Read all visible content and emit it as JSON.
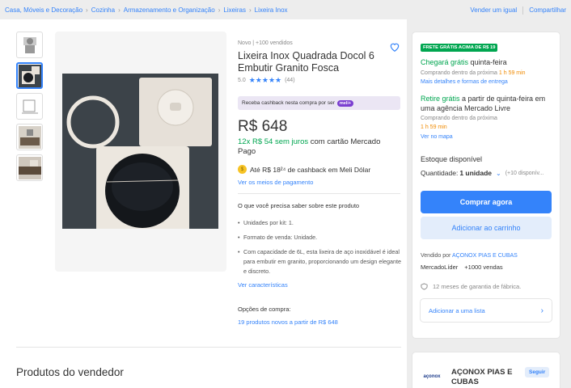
{
  "breadcrumb": [
    "Casa, Móveis e Decoração",
    "Cozinha",
    "Armazenamento e Organização",
    "Lixeiras",
    "Lixeira Inox"
  ],
  "top_links": {
    "sell": "Vender um igual",
    "share": "Compartilhar"
  },
  "product": {
    "condition": "Novo  |  +100 vendidos",
    "title": "Lixeira Inox Quadrada Docol 6 Embutir Granito Fosca",
    "rating_value": "5.0",
    "stars": "★★★★★",
    "reviews": "(44)",
    "cashback_badge": "Receba cashback nesta compra por ser",
    "cashback_pill": "meli+",
    "price": "R$ 648",
    "installments_green": "12x R$ 54 sem juros",
    "installments_rest": " com cartão Mercado Pago",
    "cashback_line": "Até R$ 18²⁴ de cashback em Meli Dólar",
    "payment_link": "Ver os meios de pagamento",
    "know_title": "O que você precisa saber sobre este produto",
    "bullets": [
      "Unidades por kit: 1.",
      "Formato de venda: Unidade.",
      "Com capacidade de 6L, esta lixeira de aço inoxidável é ideal para embutir em granito, proporcionando um design elegante e discreto."
    ],
    "characteristics_link": "Ver características",
    "options_title": "Opções de compra:",
    "options_link": "19 produtos novos a partir de R$ 648"
  },
  "seller_products_title": "Produtos do vendedor",
  "buybox": {
    "free_badge": "FRETE GRÁTIS ACIMA DE R$ 19",
    "arrives_green": "Chegará grátis",
    "arrives_rest": " quinta-feira",
    "arrives_buying": "Comprando dentro da próxima ",
    "arrives_time": "1 h 59 min",
    "more_details": "Mais detalhes e formas de entrega",
    "pickup_green": "Retire grátis",
    "pickup_rest": " a partir de quinta-feira em",
    "pickup_line2": "uma agência Mercado Livre",
    "pickup_buying": "Comprando dentro da próxima",
    "pickup_time": "1 h 59 min",
    "see_map": "Ver no mapa",
    "stock": "Estoque disponível",
    "quantity_label": "Quantidade: ",
    "quantity_value": "1 unidade",
    "quantity_avail": "(+10 disponív...",
    "buy_now": "Comprar agora",
    "add_cart": "Adicionar ao carrinho",
    "sold_by": "Vendido por ",
    "seller_link": "AÇONOX PIAS E CUBAS",
    "seller_badge": "MercadoLíder",
    "seller_sales": "+1000 vendas",
    "warranty": "12 meses de garantia de fábrica.",
    "wishlist": "Adicionar a uma lista"
  },
  "seller_card": {
    "logo_text": "açonox",
    "name": "AÇONOX PIAS E CUBAS",
    "follow": "Seguir"
  },
  "colors": {
    "accent": "#3483fa",
    "green": "#00a650",
    "orange": "#f08a00"
  }
}
